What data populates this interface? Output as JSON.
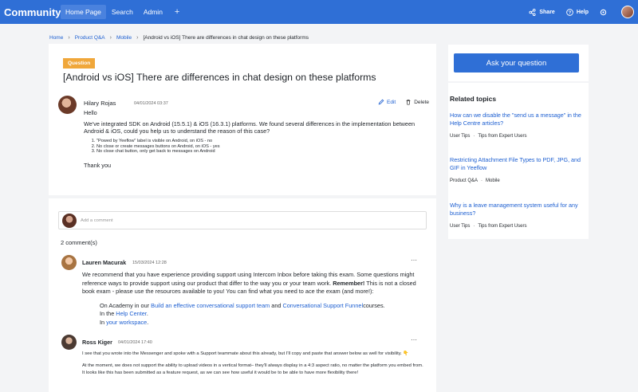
{
  "header": {
    "brand": "Community",
    "nav": [
      "Home Page",
      "Search",
      "Admin"
    ],
    "plus": "+",
    "share": "Share",
    "help": "Help"
  },
  "breadcrumb": {
    "items": [
      "Home",
      "Product Q&A",
      "Mobile"
    ],
    "current": "[Android vs iOS] There are differences in chat design on these platforms"
  },
  "question": {
    "badge": "Question",
    "title": "[Android vs iOS] There are differences in chat design on these platforms",
    "author": "Hilary Rojas",
    "date": "04/01/2024 03:37",
    "edit": "Edit",
    "delete": "Delete",
    "greeting": "Hello",
    "para1": "We've integrated SDK on Android (15.5.1) & iOS (16.3.1) platforms. We found several differences in the implementation between Android & iOS, could you help us to understand the reason of this case?",
    "list": [
      "\"Powed by Yeeflow\" label is visible on Android, on iOS - no",
      "No close or create messages buttons on Android, on iOS - yes",
      "No close chat button, only get back to messages on Android"
    ],
    "thanks": "Thank you"
  },
  "comment_input": {
    "placeholder": "Add a comment"
  },
  "comments_count": "2 comment(s)",
  "comments": [
    {
      "author": "Lauren Macurak",
      "date": "15/03/2024 12:28",
      "p1_start": "We recommend that you have experience providing support using Intercom Inbox before taking this exam. Some questions might reference ways to provide support using our product that differ to the way you or your team work. ",
      "p1_bold": "Remember!",
      "p1_end": " This is not a closed book exam - please use the resources available to you! You can find what you need to ace the exam (and more!):",
      "li1_pre": "On Academy in our ",
      "li1_link1": "Build an effective conversational support team",
      "li1_mid": " and ",
      "li1_link2": "Conversational Support Funnel",
      "li1_post": "courses.",
      "li2_pre": "In the ",
      "li2_link": "Help Center",
      "li2_post": ".",
      "li3_pre": "In ",
      "li3_link": "your workspace",
      "li3_post": "."
    },
    {
      "author": "Ross Kiger",
      "date": "04/01/2024 17:40",
      "p1": "I see that you wrote into the Messenger and spoke with a Support teammate about this already, but I'll copy and paste that answer below as well for visibility. 👇",
      "p2": "At the moment, we does not support the ability to upload videos in a vertical format– they'll always display in a 4:3 aspect ratio, no matter the platform you embed from. It looks like this has been submitted as a feature request, as we can see how useful it would be to be able to have more flexibility there!"
    }
  ],
  "sidebar": {
    "ask_button": "Ask your question",
    "related_title": "Related topics",
    "topics": [
      {
        "title": "How can we disable the \"send us a message\" in the Help Centre articles?",
        "tags": [
          "User Tips",
          "Tips from Expert Users"
        ]
      },
      {
        "title": "Restricting Attachment File Types to PDF, JPG, and GIF in Yeeflow",
        "tags": [
          "Product Q&A",
          "Mobile"
        ]
      },
      {
        "title": "Why is a leave management system useful for any business?",
        "tags": [
          "User Tips",
          "Tips from Expert Users"
        ]
      }
    ]
  }
}
